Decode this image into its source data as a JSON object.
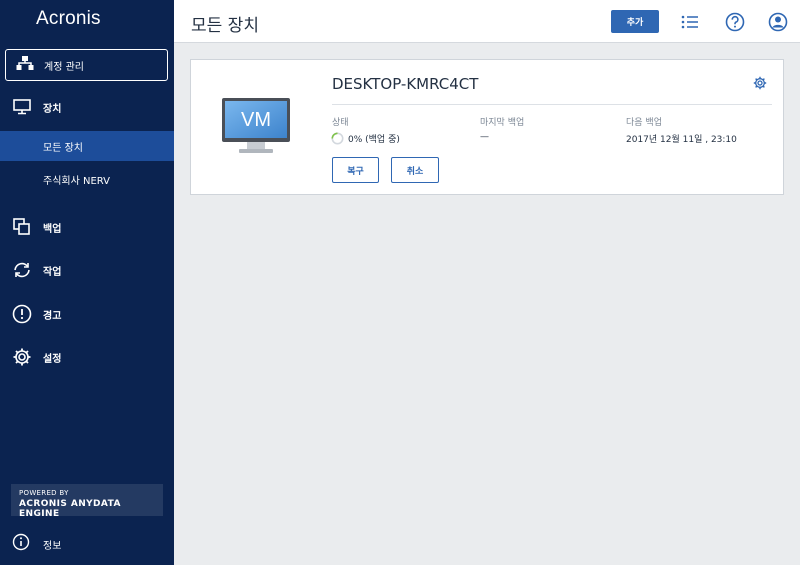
{
  "app": {
    "logo": "Acronis"
  },
  "sidebar": {
    "account_button": "계정 관리",
    "devices": "장치",
    "sub_items": [
      "모든 장치",
      "주식회사 NERV"
    ],
    "backup": "백업",
    "tasks": "작업",
    "alerts": "경고",
    "settings": "설정",
    "powered_by": "POWERED BY",
    "engine": "ACRONIS ANYDATA ENGINE",
    "info": "정보"
  },
  "header": {
    "title": "모든 장치",
    "add_button": "추가"
  },
  "device": {
    "name": "DESKTOP-KMRC4CT",
    "vm_label": "VM",
    "status_label": "상태",
    "status_value": "0% (백업 중)",
    "last_backup_label": "마지막 백업",
    "last_backup_value": "—",
    "next_backup_label": "다음 백업",
    "next_backup_value": "2017년 12월 11일 , 23:10",
    "recover_button": "복구",
    "cancel_button": "취소",
    "progress": 0
  },
  "colors": {
    "sidebar_bg": "#0b2350",
    "sidebar_active": "#1d4d9a",
    "accent": "#2f67b3",
    "page_bg": "#eaecee"
  }
}
